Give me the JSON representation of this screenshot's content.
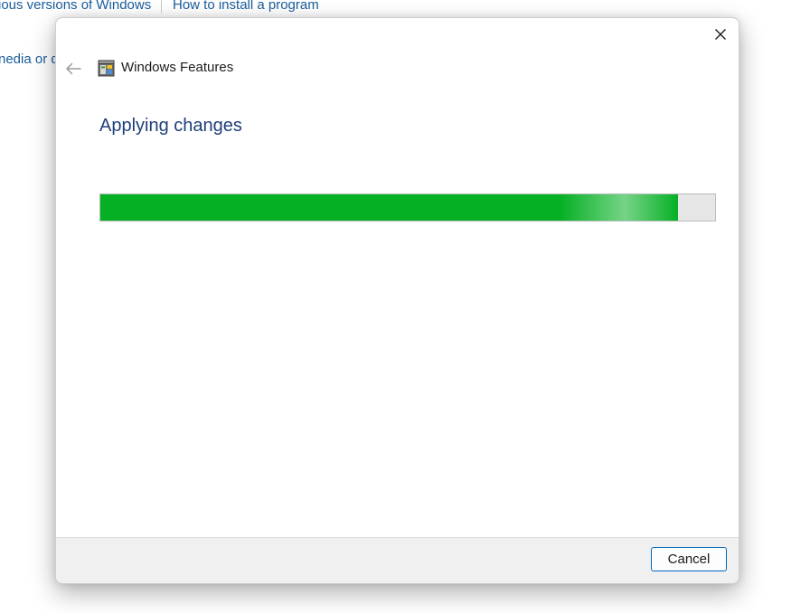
{
  "background": {
    "links": [
      "ious versions of Windows",
      "How to install a program",
      "nedia or d"
    ]
  },
  "dialog": {
    "title": "Windows Features",
    "heading": "Applying changes",
    "progress_fraction": 0.94,
    "cancel_label": "Cancel"
  },
  "colors": {
    "progress_fill": "#06b025",
    "heading": "#1e3f7a",
    "link": "#1a5d9c",
    "button_border": "#0067c0"
  },
  "icons": {
    "close": "close-icon",
    "back": "back-arrow-icon",
    "app": "windows-features-icon"
  }
}
